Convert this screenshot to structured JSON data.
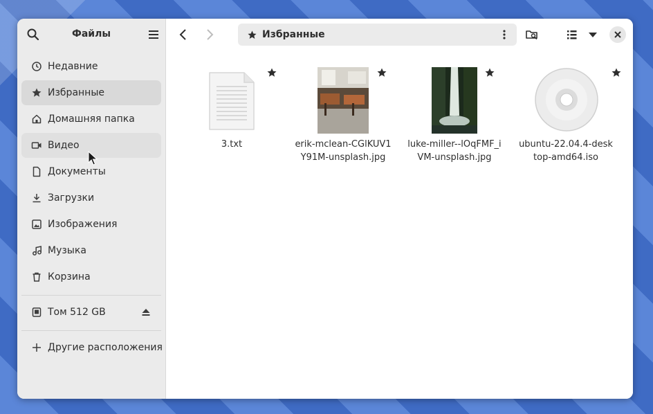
{
  "sidebar": {
    "title": "Файлы",
    "places": [
      {
        "label": "Недавние",
        "icon": "clock-icon"
      },
      {
        "label": "Избранные",
        "icon": "star-icon"
      },
      {
        "label": "Домашняя папка",
        "icon": "home-icon"
      },
      {
        "label": "Видео",
        "icon": "video-icon"
      },
      {
        "label": "Документы",
        "icon": "document-icon"
      },
      {
        "label": "Загрузки",
        "icon": "download-icon"
      },
      {
        "label": "Изображения",
        "icon": "image-icon"
      },
      {
        "label": "Музыка",
        "icon": "music-icon"
      },
      {
        "label": "Корзина",
        "icon": "trash-icon"
      }
    ],
    "selected_index": 1,
    "volume": {
      "label": "Том 512 GB",
      "icon": "drive-icon"
    },
    "other": {
      "label": "Другие расположения",
      "icon": "plus-icon"
    }
  },
  "toolbar": {
    "location": "Избранные"
  },
  "files": [
    {
      "name": "3.txt",
      "type": "text",
      "starred": true
    },
    {
      "name": "erik-mclean-CGlKUV1Y91M-unsplash.jpg",
      "type": "image-cafe",
      "starred": true
    },
    {
      "name": "luke-miller--lOqFMF_iVM-unsplash.jpg",
      "type": "image-waterfall",
      "starred": true
    },
    {
      "name": "ubuntu-22.04.4-desktop-amd64.iso",
      "type": "disc",
      "starred": true
    }
  ],
  "colors": {
    "sidebar_bg": "#ebebeb",
    "selected_bg": "#d9d9d9",
    "text": "#2e2e2e",
    "icon": "#3d3d3d"
  }
}
